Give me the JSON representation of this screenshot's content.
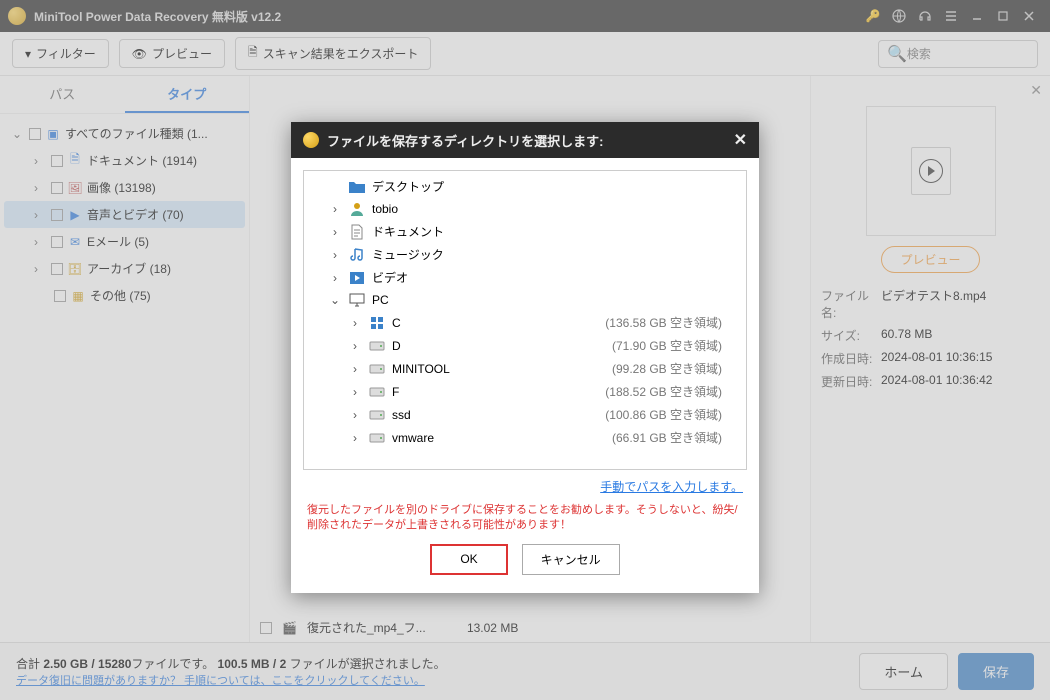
{
  "titlebar": {
    "title": "MiniTool Power Data Recovery 無料版 v12.2"
  },
  "toolbar": {
    "filter": "フィルター",
    "preview": "プレビュー",
    "export": "スキャン結果をエクスポート",
    "search_placeholder": "検索"
  },
  "tabs": {
    "path": "パス",
    "type": "タイプ"
  },
  "tree": {
    "all": "すべてのファイル種類 (1...",
    "docs": "ドキュメント (1914)",
    "images": "画像 (13198)",
    "av": "音声とビデオ (70)",
    "email": "Eメール (5)",
    "archive": "アーカイブ (18)",
    "other": "その他 (75)"
  },
  "filelist": {
    "name": "復元された_mp4_フ...",
    "size": "13.02 MB"
  },
  "preview": {
    "btn": "プレビュー",
    "filename_label": "ファイル名:",
    "filename": "ビデオテスト8.mp4",
    "size_label": "サイズ:",
    "size": "60.78 MB",
    "created_label": "作成日時:",
    "created": "2024-08-01 10:36:15",
    "modified_label": "更新日時:",
    "modified": "2024-08-01 10:36:42"
  },
  "footer": {
    "total_prefix": "合計 ",
    "total": "2.50 GB / 15280",
    "total_suffix": "ファイルです。 ",
    "selected": "100.5 MB / 2",
    "selected_suffix": " ファイルが選択されました。",
    "help_link": "データ復旧に問題がありますか？ 手順については、ここをクリックしてください。",
    "home": "ホーム",
    "save": "保存"
  },
  "dialog": {
    "title": "ファイルを保存するディレクトリを選択します:",
    "manual_link": "手動でパスを入力します。",
    "warning": "復元したファイルを別のドライブに保存することをお勧めします。そうしないと、紛失/削除されたデータが上書きされる可能性があります！",
    "ok": "OK",
    "cancel": "キャンセル",
    "nodes": [
      {
        "depth": 1,
        "exp": "",
        "icon": "folder-blue",
        "label": "デスクトップ",
        "free": ""
      },
      {
        "depth": 1,
        "exp": ">",
        "icon": "user",
        "label": "tobio",
        "free": ""
      },
      {
        "depth": 1,
        "exp": ">",
        "icon": "doc",
        "label": "ドキュメント",
        "free": ""
      },
      {
        "depth": 1,
        "exp": ">",
        "icon": "music",
        "label": "ミュージック",
        "free": ""
      },
      {
        "depth": 1,
        "exp": ">",
        "icon": "video",
        "label": "ビデオ",
        "free": ""
      },
      {
        "depth": 1,
        "exp": "v",
        "icon": "pc",
        "label": "PC",
        "free": ""
      },
      {
        "depth": 2,
        "exp": ">",
        "icon": "win",
        "label": "C",
        "free": "(136.58 GB 空き領域)"
      },
      {
        "depth": 2,
        "exp": ">",
        "icon": "drive",
        "label": "D",
        "free": "(71.90 GB 空き領域)"
      },
      {
        "depth": 2,
        "exp": ">",
        "icon": "drive",
        "label": "MINITOOL",
        "free": "(99.28 GB 空き領域)"
      },
      {
        "depth": 2,
        "exp": ">",
        "icon": "drive",
        "label": "F",
        "free": "(188.52 GB 空き領域)"
      },
      {
        "depth": 2,
        "exp": ">",
        "icon": "drive",
        "label": "ssd",
        "free": "(100.86 GB 空き領域)"
      },
      {
        "depth": 2,
        "exp": ">",
        "icon": "drive",
        "label": "vmware",
        "free": "(66.91 GB 空き領域)"
      }
    ]
  }
}
